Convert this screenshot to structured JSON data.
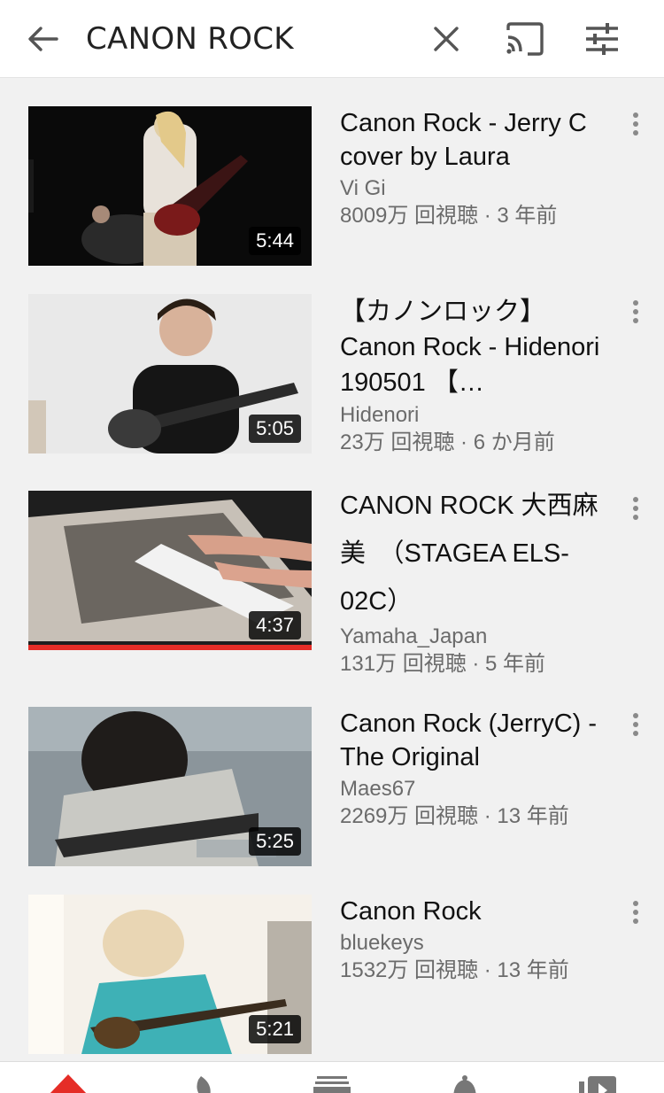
{
  "header": {
    "back_icon": "arrow-left-icon",
    "query": "CANON ROCK",
    "clear_icon": "close-icon",
    "cast_icon": "cast-icon",
    "filter_icon": "tune-icon"
  },
  "results": [
    {
      "title": "Canon Rock - Jerry C cover by Laura",
      "channel": "Vi Gi",
      "stats": "8009万 回視聴 · 3 年前",
      "duration": "5:44"
    },
    {
      "title": "【カノンロック】Canon Rock - Hidenori 190501 【…",
      "channel": "Hidenori",
      "stats": "23万 回視聴 · 6 か月前",
      "duration": "5:05"
    },
    {
      "title": "CANON ROCK 大西麻美　（STAGEA ELS-02C）",
      "channel": "Yamaha_Japan",
      "stats": "131万 回視聴 · 5 年前",
      "duration": "4:37",
      "watched_fraction": 1.0
    },
    {
      "title": "Canon Rock (JerryC) - The Original",
      "channel": "Maes67",
      "stats": "2269万 回視聴 · 13 年前",
      "duration": "5:25"
    },
    {
      "title": "Canon Rock",
      "channel": "bluekeys",
      "stats": "1532万 回視聴 · 13 年前",
      "duration": "5:21"
    }
  ],
  "bottom_nav": {
    "items": [
      "home-icon",
      "trending-icon",
      "subscriptions-icon",
      "notifications-icon",
      "library-icon"
    ],
    "accent_color": "#e52d27"
  }
}
